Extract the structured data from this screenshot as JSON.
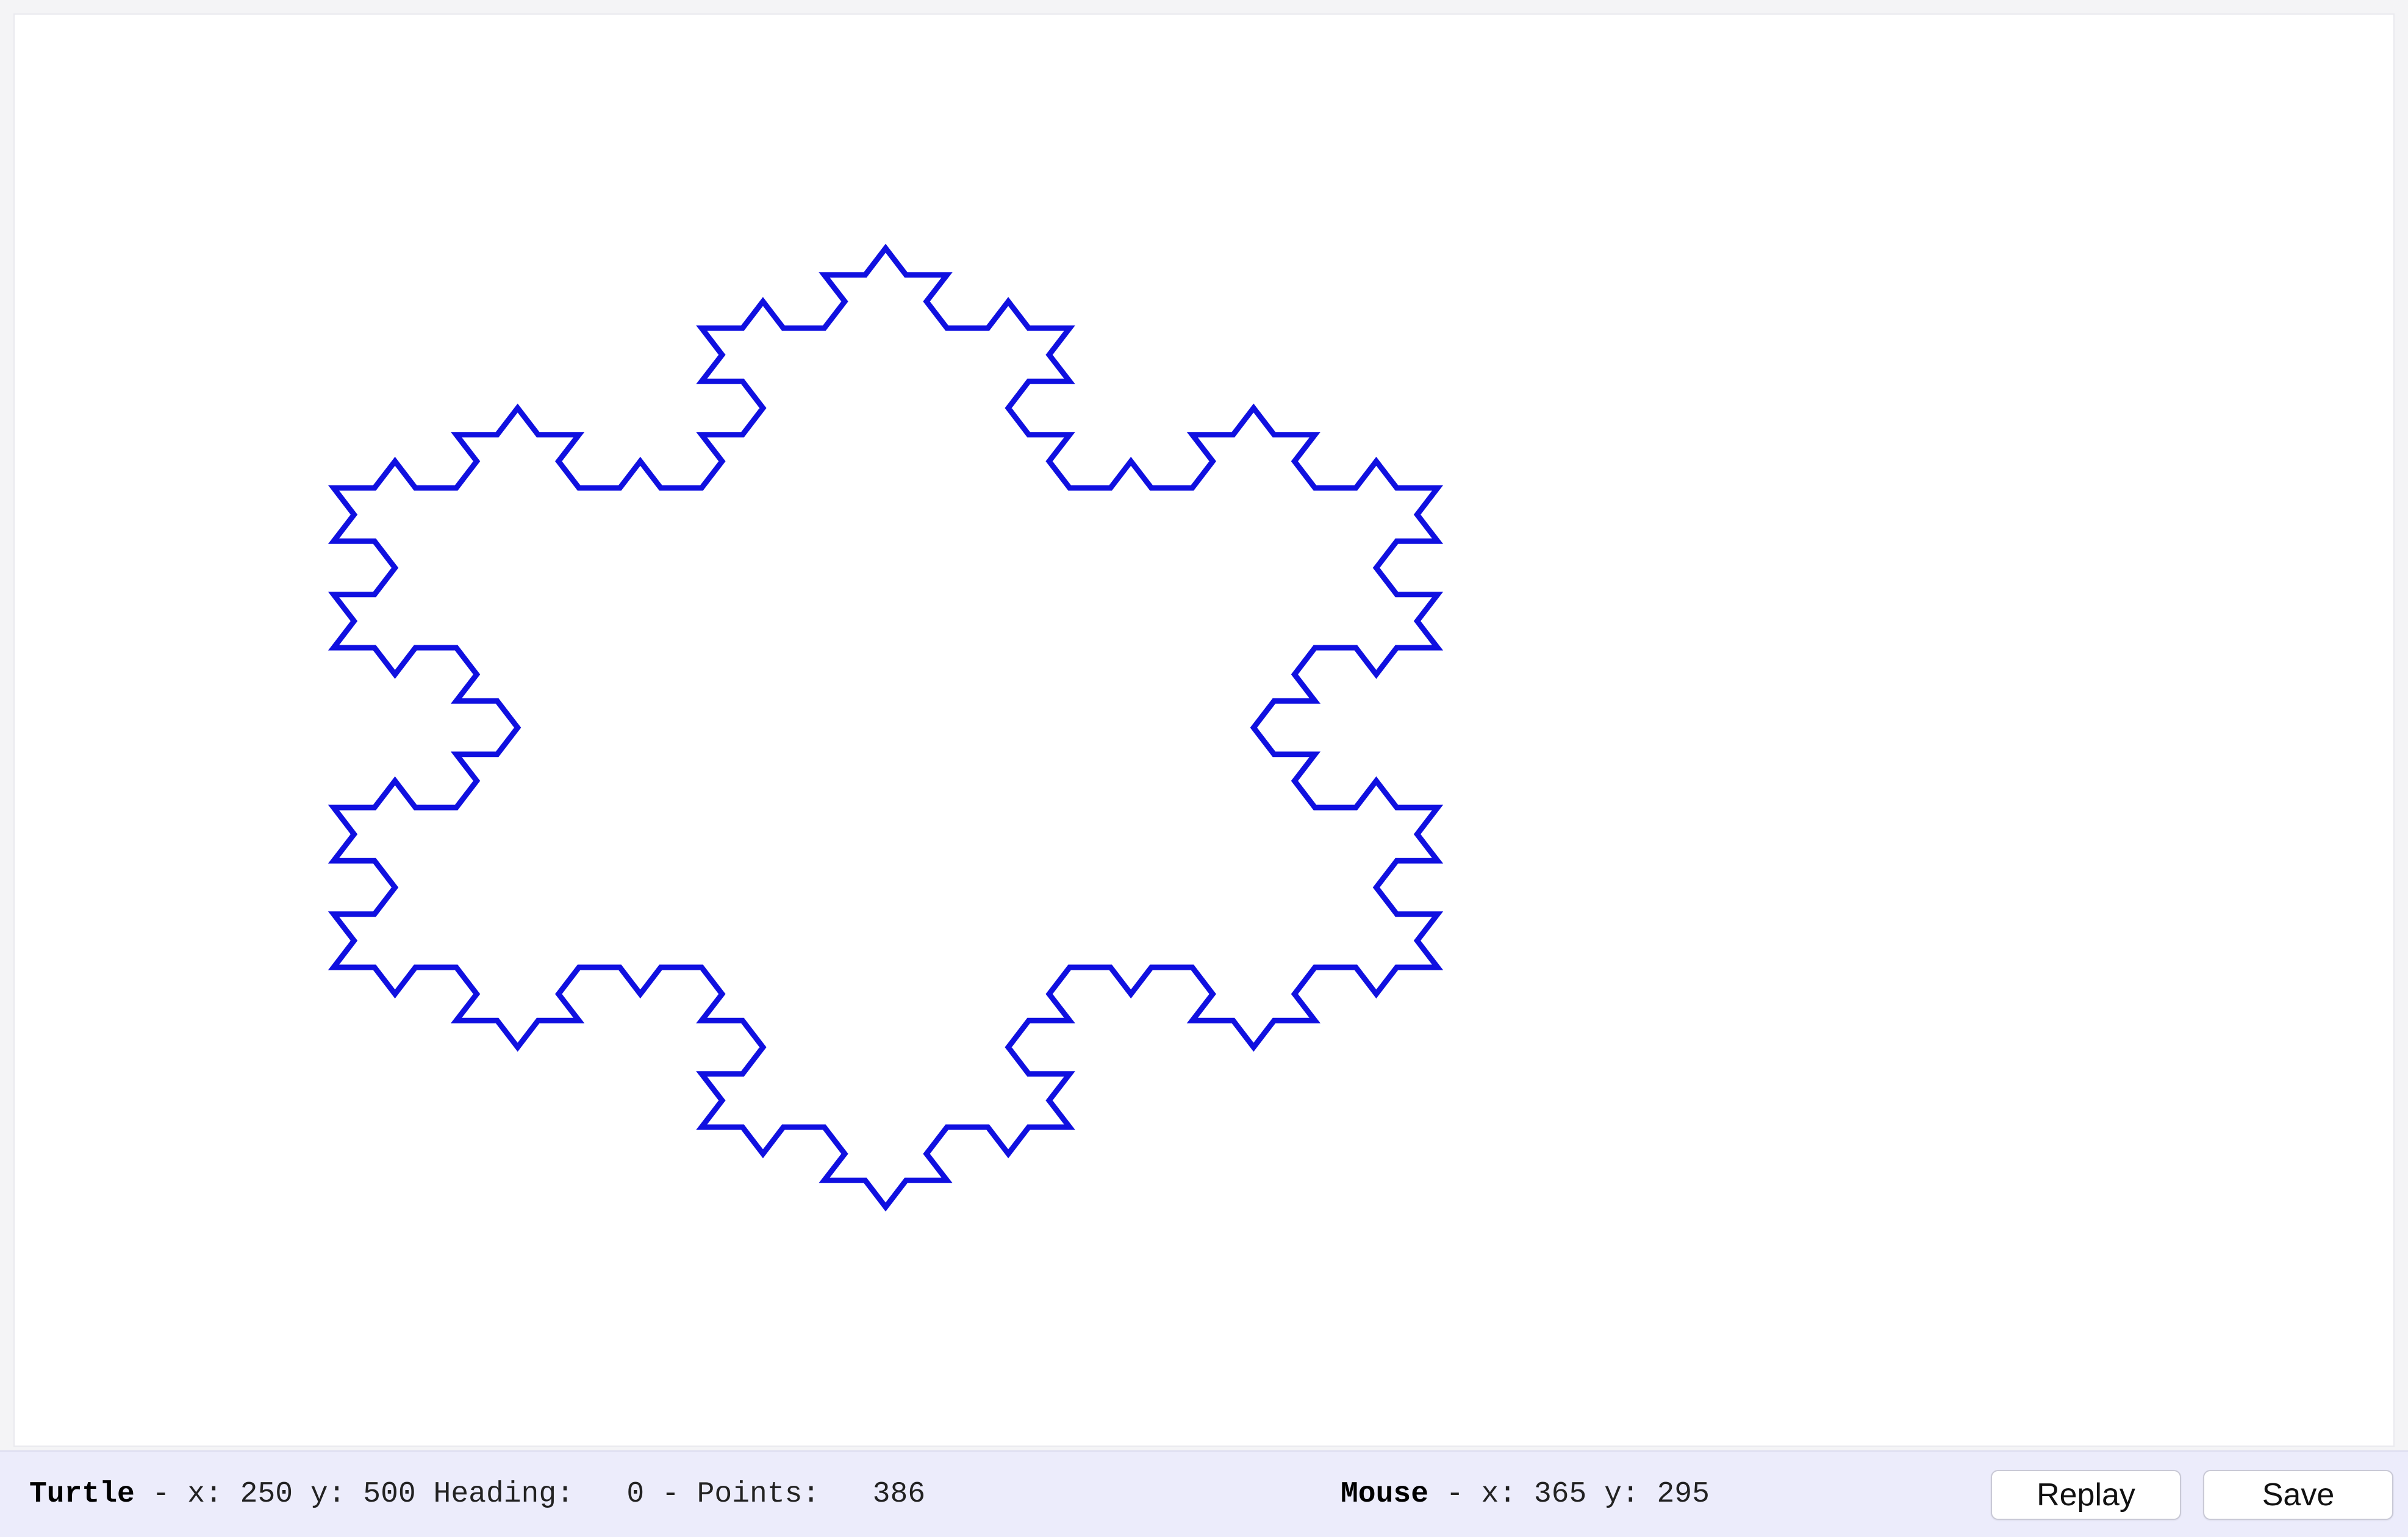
{
  "canvas": {
    "stroke_color": "#1010e0",
    "background": "#ffffff",
    "drawing": "koch-snowflake"
  },
  "status": {
    "turtle_label": "Turtle",
    "turtle_x_label": " - x: ",
    "turtle_x": "250",
    "turtle_y_label": " y: ",
    "turtle_y": "500",
    "heading_label": " Heading:   ",
    "heading": "0",
    "points_label": " - Points:   ",
    "points": "386",
    "mouse_label": "Mouse",
    "mouse_x_label": " - x: ",
    "mouse_x": "365",
    "mouse_y_label": " y: ",
    "mouse_y": "295"
  },
  "buttons": {
    "replay_label": "Replay",
    "save_label": "Save"
  }
}
